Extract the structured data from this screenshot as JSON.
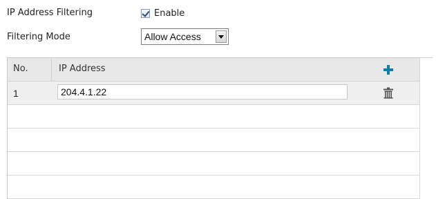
{
  "form": {
    "ip_filtering_label": "IP Address Filtering",
    "enable_label": "Enable",
    "enable_checked": true,
    "filtering_mode_label": "Filtering Mode",
    "filtering_mode_value": "Allow Access"
  },
  "table": {
    "columns": [
      "No.",
      "IP Address"
    ],
    "rows": [
      {
        "no": "1",
        "ip": "204.4.1.22"
      }
    ],
    "empty_rows": 4
  },
  "colors": {
    "accent": "#0c7fa6",
    "header_bg": "#e8e8e8",
    "selected_row_bg": "#efefef"
  },
  "icons": {
    "add": "plus-icon",
    "delete": "trash-icon",
    "dropdown": "chevron-down-icon"
  }
}
